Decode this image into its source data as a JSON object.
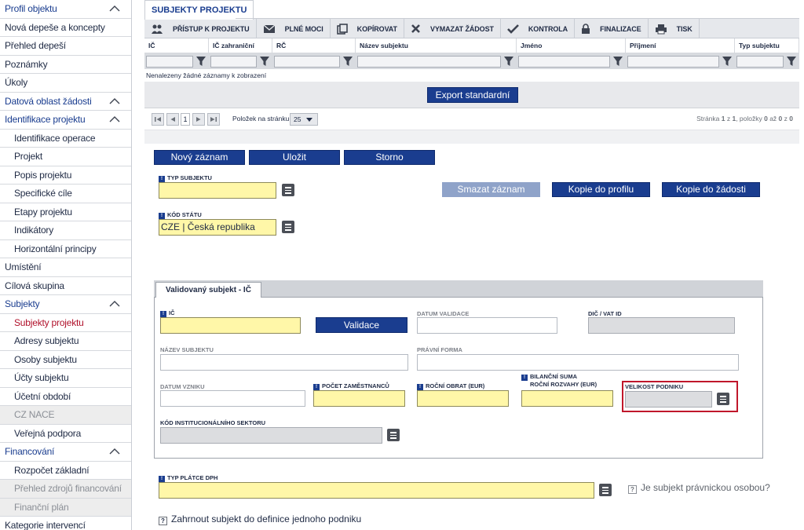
{
  "sidebar": {
    "items": [
      {
        "label": "Profil objektu",
        "kind": "section",
        "chevron": true
      },
      {
        "label": "Nová depeše a koncepty",
        "kind": "item"
      },
      {
        "label": "Přehled depeší",
        "kind": "item"
      },
      {
        "label": "Poznámky",
        "kind": "item"
      },
      {
        "label": "Úkoly",
        "kind": "item"
      },
      {
        "label": "Datová oblast žádosti",
        "kind": "section",
        "chevron": true
      },
      {
        "label": "Identifikace projektu",
        "kind": "section",
        "chevron": true
      },
      {
        "label": "Identifikace operace",
        "kind": "sub"
      },
      {
        "label": "Projekt",
        "kind": "sub"
      },
      {
        "label": "Popis projektu",
        "kind": "sub"
      },
      {
        "label": "Specifické cíle",
        "kind": "sub"
      },
      {
        "label": "Etapy projektu",
        "kind": "sub"
      },
      {
        "label": "Indikátory",
        "kind": "sub"
      },
      {
        "label": "Horizontální principy",
        "kind": "sub"
      },
      {
        "label": "Umístění",
        "kind": "item"
      },
      {
        "label": "Cílová skupina",
        "kind": "item"
      },
      {
        "label": "Subjekty",
        "kind": "section",
        "chevron": true
      },
      {
        "label": "Subjekty projektu",
        "kind": "sub-active"
      },
      {
        "label": "Adresy subjektu",
        "kind": "sub"
      },
      {
        "label": "Osoby subjektu",
        "kind": "sub"
      },
      {
        "label": "Účty subjektu",
        "kind": "sub"
      },
      {
        "label": "Účetní období",
        "kind": "sub"
      },
      {
        "label": "CZ NACE",
        "kind": "sub-disabled"
      },
      {
        "label": "Veřejná podpora",
        "kind": "sub"
      },
      {
        "label": "Financování",
        "kind": "section",
        "chevron": true
      },
      {
        "label": "Rozpočet základní",
        "kind": "sub"
      },
      {
        "label": "Přehled zdrojů financování",
        "kind": "sub-disabled"
      },
      {
        "label": "Finanční plán",
        "kind": "sub-disabled"
      },
      {
        "label": "Kategorie intervencí",
        "kind": "item"
      }
    ]
  },
  "tab": {
    "label": "SUBJEKTY PROJEKTU"
  },
  "toolbar": {
    "buttons": [
      {
        "label": "PŘÍSTUP K PROJEKTU",
        "icon": "people-icon"
      },
      {
        "label": "PLNÉ MOCI",
        "icon": "envelope-icon"
      },
      {
        "label": "KOPÍROVAT",
        "icon": "copy-icon"
      },
      {
        "label": "VYMAZAT ŽÁDOST",
        "icon": "x-icon"
      },
      {
        "label": "KONTROLA",
        "icon": "check-icon"
      },
      {
        "label": "FINALIZACE",
        "icon": "lock-icon"
      },
      {
        "label": "TISK",
        "icon": "printer-icon"
      }
    ]
  },
  "grid": {
    "columns": [
      "IČ",
      "IČ zahraniční",
      "RČ",
      "Název subjektu",
      "Jméno",
      "Příjmení",
      "Typ subjektu"
    ],
    "empty_text": "Nenalezeny žádné záznamy k zobrazení",
    "export_label": "Export standardní"
  },
  "pager": {
    "page": "1",
    "per_page_label": "Položek na stránku",
    "per_page": "25",
    "info_prefix": "Stránka ",
    "info_page": "1",
    "info_of": " z ",
    "info_total_pages": "1",
    "info_items": ", položky ",
    "info_from": "0",
    "info_to_word": " až ",
    "info_to": "0",
    "info_of2": " z ",
    "info_total": "0"
  },
  "form": {
    "new_record": "Nový záznam",
    "save": "Uložit",
    "cancel": "Storno",
    "delete_record": "Smazat záznam",
    "copy_to_profile": "Kopie do profilu",
    "copy_to_request": "Kopie do žádosti",
    "typ_subjektu_label": "TYP SUBJEKTU",
    "typ_subjektu_value": "",
    "kod_statu_label": "KÓD STÁTU",
    "kod_statu_value": "CZE | Česká republika",
    "validated_tab": "Validovaný subjekt - IČ",
    "ic_label": "IČ",
    "validate_button": "Validace",
    "datum_validace_label": "DATUM VALIDACE",
    "dic_label": "DIČ / VAT ID",
    "nazev_subjektu_label": "NÁZEV SUBJEKTU",
    "pravni_forma_label": "PRÁVNÍ FORMA",
    "datum_vzniku_label": "DATUM VZNIKU",
    "pocet_zamestnancu_label": "POČET ZAMĚSTNANCŮ",
    "rocni_obrat_label": "ROČNÍ OBRAT (EUR)",
    "bilancni_suma_label_1": "BILANČNÍ SUMA",
    "bilancni_suma_label_2": "ROČNÍ ROZVAHY (EUR)",
    "velikost_podniku_label": "VELIKOST PODNIKU",
    "kod_sektoru_label": "KÓD INSTITUCIONÁLNÍHO SEKTORU",
    "typ_platce_dph_label": "TYP PLÁTCE DPH",
    "pravnicka_osoba_label": "Je subjekt právnickou osobou?",
    "zahrnout_label": "Zahrnout subjekt do definice jednoho podniku"
  },
  "colors": {
    "accent": "#1a3d8f",
    "required_field": "#fff7a8",
    "highlight_frame": "#c0172b",
    "active_nav": "#b0102a"
  }
}
